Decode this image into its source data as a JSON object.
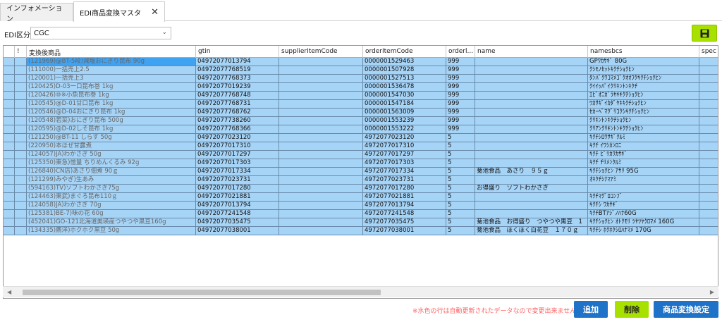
{
  "tabs": [
    {
      "label": "インフォメーション"
    },
    {
      "label": "EDI商品変換マスタ",
      "close": "✕"
    }
  ],
  "filter": {
    "label": "EDI区分",
    "value": "CGC"
  },
  "columns": [
    "!",
    "変換後商品",
    "gtin",
    "supplierItemCode",
    "orderItemCode",
    "orderl...",
    "name",
    "namesbcs",
    "spec"
  ],
  "rows": [
    {
      "product": "(121969)@BT-5段)減塩おにぎり昆布 90g",
      "gtin": "04972077013794",
      "supplier": "",
      "order": "0000001529463",
      "orderl": "999",
      "name": "",
      "namesbcs": "GPﾜｶｻｷﾞ 80G"
    },
    {
      "product": "(111000)一括売上2.5",
      "gtin": "04972077768519",
      "supplier": "",
      "order": "0000001507928",
      "orderl": "999",
      "name": "",
      "namesbcs": "ｸｼﾓﾉｾｯﾄｷｸﾁｼｮｸﾋﾝ"
    },
    {
      "product": "(120001)一括売上3",
      "gtin": "04972077768373",
      "supplier": "",
      "order": "0000001527513",
      "orderl": "999",
      "name": "",
      "namesbcs": "ﾀﾝﾊﾞｸﾜｺﾏﾒｺﾞｸｵｵﾌｸｷｸﾁｼｮｸﾋﾝ"
    },
    {
      "product": "(120425)D-03一口昆布巻 1kg",
      "gtin": "04972077019239",
      "supplier": "",
      "order": "0000001536478",
      "orderl": "999",
      "name": "",
      "namesbcs": "ｸｲｲｯﾊﾟｲｸﾘｷﾝﾄﾝｷｸﾁ"
    },
    {
      "product": "(120426)⑩※小魚昆布巻 1kg",
      "gtin": "04972077768748",
      "supplier": "",
      "order": "0000001547030",
      "orderl": "999",
      "name": "",
      "namesbcs": "ｴﾋﾞｵﾆｶﾞﾗﾔｷｷｸﾁｼｮｸﾋﾝ"
    },
    {
      "product": "(120545)@D-01甘口昆布 1kg",
      "gtin": "04972077768731",
      "supplier": "",
      "order": "0000001547184",
      "orderl": "999",
      "name": "",
      "namesbcs": "ﾜｶｻｷﾞｲｶﾀﾞﾔｷｷｸﾁｼｮｸﾋﾝ"
    },
    {
      "product": "(120546)@D-04おにぎり昆布 1kg",
      "gtin": "04972077768762",
      "supplier": "",
      "order": "0000001563009",
      "orderl": "999",
      "name": "",
      "namesbcs": "ｾｶｰﾍﾞﾏｸﾞﾘｺｸｼｷｸﾁｼｮｸﾋﾝ"
    },
    {
      "product": "(120548)若菜)おにぎり昆布 500g",
      "gtin": "04972077738260",
      "supplier": "",
      "order": "0000001553239",
      "orderl": "999",
      "name": "",
      "namesbcs": "ｸﾘｷﾝﾄﾝｷｸﾁｼｮｸﾋﾝ"
    },
    {
      "product": "(120595)@D-02しそ昆布 1kg",
      "gtin": "04972077768366",
      "supplier": "",
      "order": "0000001553222",
      "orderl": "999",
      "name": "",
      "namesbcs": "ｸﾘｱﾝｸﾘｷﾝﾄﾝｷｸﾁｼｮｸﾋﾝ"
    },
    {
      "product": "(121250)@BT-11 しらす 50g",
      "gtin": "04972077023120",
      "supplier": "",
      "order": "4972077023120",
      "orderl": "5",
      "name": "",
      "namesbcs": "ｷｸﾁｼﾛｳｻｷﾞｸﾙﾐ"
    },
    {
      "product": "(220950)本ほぜ甘露煮",
      "gtin": "04972077017310",
      "supplier": "",
      "order": "4972077017310",
      "orderl": "5",
      "name": "",
      "namesbcs": "ｷｸﾁ ｲﾜｼｶﾝﾛﾆ"
    },
    {
      "product": "(124057)JA)わかさぎ 50g",
      "gtin": "04972077017297",
      "supplier": "",
      "order": "4972077017297",
      "orderl": "5",
      "name": "",
      "namesbcs": "ｷｸﾁ ﾋﾞﾘｶﾜｶｻｷﾞ"
    },
    {
      "product": "(125350)東急)憎量 ちりめんくるみ 92g",
      "gtin": "04972077017303",
      "supplier": "",
      "order": "4972077017303",
      "orderl": "5",
      "name": "",
      "namesbcs": "ｷｸﾁ ﾁﾘﾒﾝｸﾙﾐ"
    },
    {
      "product": "(126840)CN店)あさり佃煮 90ｇ",
      "gtin": "04972077017334",
      "supplier": "",
      "order": "4972077017334",
      "orderl": "5",
      "name": "菊池食品　あさり　９５ｇ",
      "namesbcs": "ｷｸﾁｼｮｸﾋﾝ ｱｻﾘ 95G"
    },
    {
      "product": "(121299)みやぎ)生あみ",
      "gtin": "04972077023731",
      "supplier": "",
      "order": "4972077023731",
      "orderl": "5",
      "name": "",
      "namesbcs": "ｵｷｸﾁｼﾅﾏｱﾐ"
    },
    {
      "product": "(594163)TV)ソフトわかさぎ75g",
      "gtin": "04972077017280",
      "supplier": "",
      "order": "4972077017280",
      "orderl": "5",
      "name": "お得盛り　ソフトわかさぎ",
      "namesbcs": ""
    },
    {
      "product": "(124463)東武)まぐろ昆布110ｇ",
      "gtin": "04972077021881",
      "supplier": "",
      "order": "4972077021881",
      "orderl": "5",
      "name": "",
      "namesbcs": "ｷｸﾁﾏｸﾞﾛｺﾝﾌﾞ"
    },
    {
      "product": "(124058)JA)わかさぎ 70g",
      "gtin": "04972077013794",
      "supplier": "",
      "order": "4972077013794",
      "orderl": "5",
      "name": "",
      "namesbcs": "ｷｸﾁｼ ﾜｶｻｷﾞ"
    },
    {
      "product": "(125381)BE-7)味の花 60g",
      "gtin": "04972077241548",
      "supplier": "",
      "order": "4972077241548",
      "orderl": "5",
      "name": "",
      "namesbcs": "ｷｸﾁBTｱｼﾞﾉﾊﾅ60G"
    },
    {
      "product": "(452041)GO-121北海道美瑛産つやつや黒豆160g",
      "gtin": "04972077035475",
      "supplier": "",
      "order": "4972077035475",
      "orderl": "5",
      "name": "菊池食品　お得盛り　つやつや黒豆　1",
      "namesbcs": "ｷｸﾁｼｮｸﾋﾝ ｵﾄｸﾓﾘ ﾂﾔﾂﾔｸﾛﾏﾒ 160G"
    },
    {
      "product": "(134335)薦洋)ホクホク黒豆 50g",
      "gtin": "04972077038001",
      "supplier": "",
      "order": "4972077038001",
      "orderl": "5",
      "name": "菊池食品　ほくほく白花豆　１７０ｇ",
      "namesbcs": "ｷｸﾁｼ ﾎｸﾎｸｼﾛﾊﾅﾏﾒ 170G"
    }
  ],
  "footer": {
    "note": "※水色の行は自動更新されたデータなので変更出来ません。",
    "add_label": "追加",
    "delete_label": "削除",
    "convert_label": "商品変換設定"
  },
  "colors": {
    "row": "#a6d4f7",
    "selected": "#3fa3f2",
    "green": "#a8e000",
    "blue": "#1e72c7",
    "note": "#ff5f5f"
  }
}
